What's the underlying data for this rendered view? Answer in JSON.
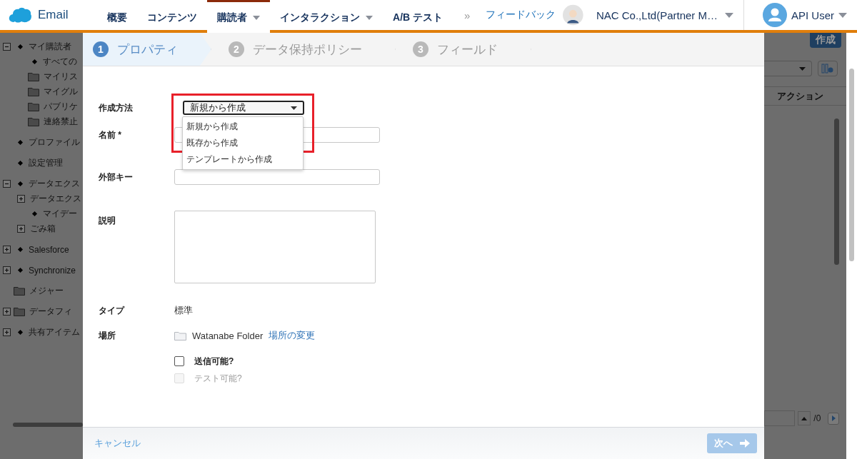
{
  "app": {
    "name": "Email"
  },
  "nav": {
    "tabs": [
      {
        "label": "概要",
        "selected": false,
        "dropdown": false
      },
      {
        "label": "コンテンツ",
        "selected": false,
        "dropdown": false
      },
      {
        "label": "購読者",
        "selected": true,
        "dropdown": true
      },
      {
        "label": "インタラクション",
        "selected": false,
        "dropdown": true
      },
      {
        "label": "A/B テスト",
        "selected": false,
        "dropdown": false
      }
    ],
    "overflow": "»",
    "feedback": "フィードバック",
    "account": "NAC Co.,Ltd(Partner M…",
    "user": "API User"
  },
  "tree": [
    {
      "kind": "bullet",
      "label": "マイ購読者",
      "expanded": true,
      "children": [
        {
          "kind": "bullet",
          "label": "すべての"
        },
        {
          "kind": "folder",
          "label": "マイリス"
        },
        {
          "kind": "folder",
          "label": "マイグル"
        },
        {
          "kind": "folder",
          "label": "パブリケ"
        },
        {
          "kind": "folder",
          "label": "連絡禁止"
        }
      ]
    },
    {
      "kind": "bullet",
      "label": "プロファイル"
    },
    {
      "kind": "bullet",
      "label": "設定管理"
    },
    {
      "kind": "bullet",
      "label": "データエクス",
      "expanded": true,
      "children": [
        {
          "kind": "plain",
          "label": "データエクス",
          "expanded": false
        },
        {
          "kind": "bullet",
          "label": "マイデー"
        },
        {
          "kind": "plain",
          "label": "ごみ箱",
          "expanded": false
        }
      ]
    },
    {
      "kind": "bullet",
      "label": "Salesforce",
      "expanded": false
    },
    {
      "kind": "bullet",
      "label": "Synchronize",
      "expanded": false
    },
    {
      "kind": "folder",
      "label": "メジャー"
    },
    {
      "kind": "folder",
      "label": "データフィ",
      "expanded": false
    },
    {
      "kind": "bullet",
      "label": "共有アイテム",
      "expanded": false
    }
  ],
  "right_panel": {
    "create_button": "作成",
    "column_header": "アクション",
    "pager_total": "/0"
  },
  "dialog": {
    "steps": [
      {
        "number": "1",
        "label": "プロパティ",
        "selected": true
      },
      {
        "number": "2",
        "label": "データ保持ポリシー",
        "selected": false
      },
      {
        "number": "3",
        "label": "フィールド",
        "selected": false
      }
    ],
    "form": [
      {
        "kind": "select",
        "label": "作成方法",
        "value": "新規から作成",
        "expanded": true,
        "highlighted": true,
        "options": [
          "新規から作成",
          "既存から作成",
          "テンプレートから作成"
        ]
      },
      {
        "kind": "text",
        "label": "名前 *"
      },
      {
        "kind": "text",
        "label": "外部キー"
      },
      {
        "kind": "textarea",
        "label": "説明"
      },
      {
        "kind": "static",
        "label": "タイプ",
        "value": "標準"
      },
      {
        "kind": "location",
        "label": "場所",
        "value": "Watanabe Folder",
        "link": "場所の変更"
      }
    ],
    "checkboxes": [
      {
        "label": "送信可能?",
        "checked": false,
        "disabled": false
      },
      {
        "label": "テスト可能?",
        "checked": false,
        "disabled": true
      }
    ],
    "footer": {
      "cancel": "キャンセル",
      "next": {
        "label": "次へ",
        "disabled": true
      }
    }
  }
}
